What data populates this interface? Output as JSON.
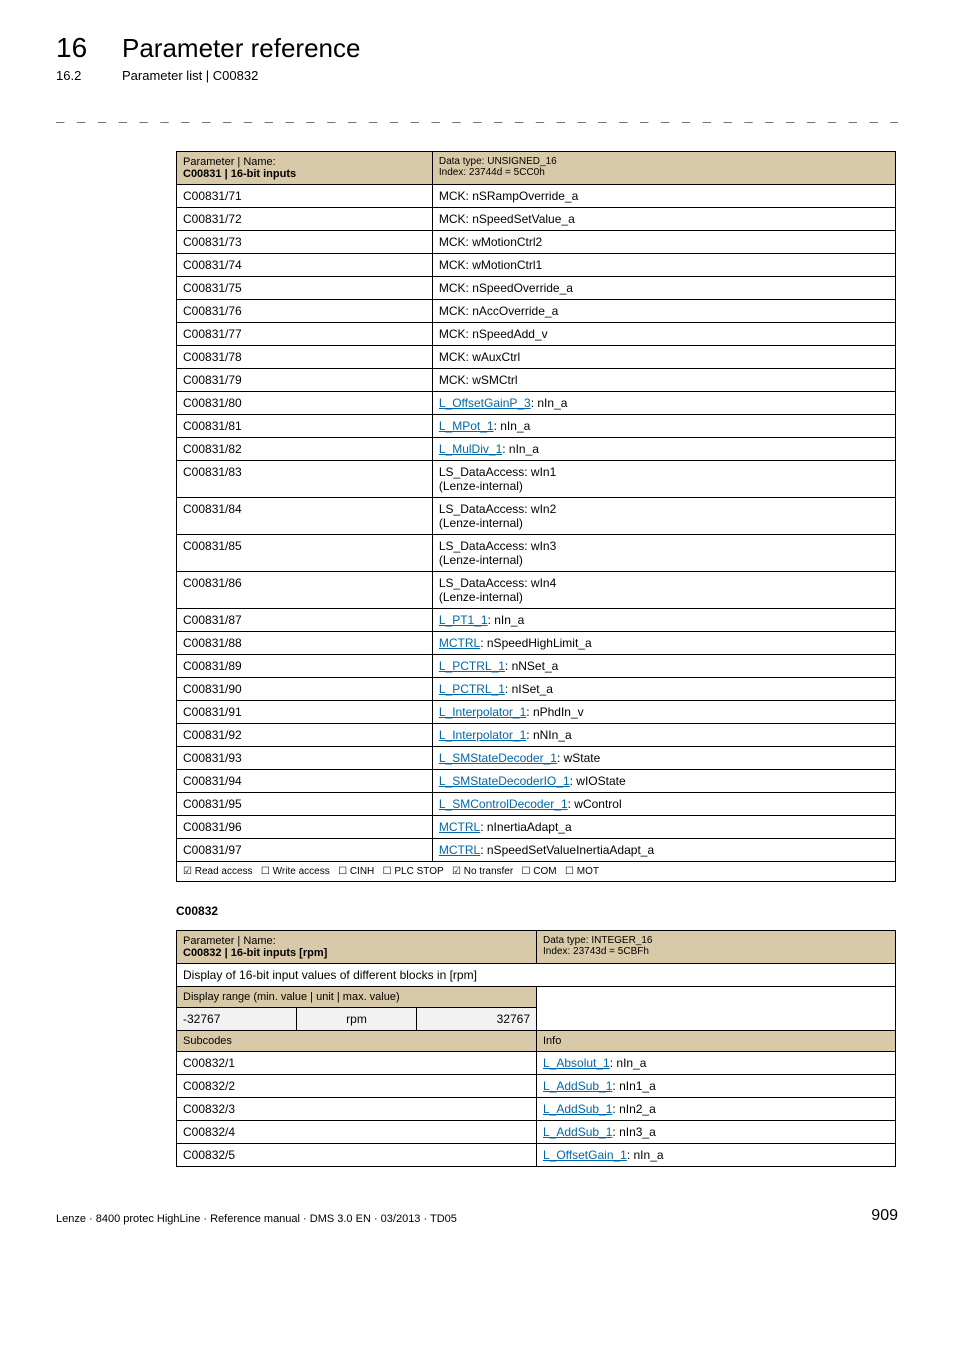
{
  "header": {
    "chapter_num": "16",
    "chapter_title": "Parameter reference",
    "sub_num": "16.2",
    "sub_title": "Parameter list | C00832"
  },
  "table1": {
    "hdr_left_line1": "Parameter | Name:",
    "hdr_left_line2": "C00831 | 16-bit inputs",
    "hdr_right_line1": "Data type: UNSIGNED_16",
    "hdr_right_line2": "Index: 23744d = 5CC0h",
    "rows": [
      {
        "c1": "C00831/71",
        "c2": "MCK: nSRampOverride_a",
        "link": null,
        "suffix": null
      },
      {
        "c1": "C00831/72",
        "c2": "MCK: nSpeedSetValue_a",
        "link": null,
        "suffix": null
      },
      {
        "c1": "C00831/73",
        "c2": "MCK: wMotionCtrl2",
        "link": null,
        "suffix": null
      },
      {
        "c1": "C00831/74",
        "c2": "MCK: wMotionCtrl1",
        "link": null,
        "suffix": null
      },
      {
        "c1": "C00831/75",
        "c2": "MCK: nSpeedOverride_a",
        "link": null,
        "suffix": null
      },
      {
        "c1": "C00831/76",
        "c2": "MCK: nAccOverride_a",
        "link": null,
        "suffix": null
      },
      {
        "c1": "C00831/77",
        "c2": "MCK: nSpeedAdd_v",
        "link": null,
        "suffix": null
      },
      {
        "c1": "C00831/78",
        "c2": "MCK: wAuxCtrl",
        "link": null,
        "suffix": null
      },
      {
        "c1": "C00831/79",
        "c2": "MCK: wSMCtrl",
        "link": null,
        "suffix": null
      },
      {
        "c1": "C00831/80",
        "c2": null,
        "link": "L_OffsetGainP_3",
        "suffix": ": nIn_a"
      },
      {
        "c1": "C00831/81",
        "c2": null,
        "link": "L_MPot_1",
        "suffix": ": nIn_a"
      },
      {
        "c1": "C00831/82",
        "c2": null,
        "link": "L_MulDiv_1",
        "suffix": ": nIn_a"
      },
      {
        "c1": "C00831/83",
        "c2": "LS_DataAccess: wIn1\n(Lenze-internal)",
        "link": null,
        "suffix": null
      },
      {
        "c1": "C00831/84",
        "c2": "LS_DataAccess: wIn2\n(Lenze-internal)",
        "link": null,
        "suffix": null
      },
      {
        "c1": "C00831/85",
        "c2": "LS_DataAccess: wIn3\n(Lenze-internal)",
        "link": null,
        "suffix": null
      },
      {
        "c1": "C00831/86",
        "c2": "LS_DataAccess: wIn4\n(Lenze-internal)",
        "link": null,
        "suffix": null
      },
      {
        "c1": "C00831/87",
        "c2": null,
        "link": "L_PT1_1",
        "suffix": ": nIn_a"
      },
      {
        "c1": "C00831/88",
        "c2": null,
        "link": "MCTRL",
        "suffix": ": nSpeedHighLimit_a"
      },
      {
        "c1": "C00831/89",
        "c2": null,
        "link": "L_PCTRL_1",
        "suffix": ": nNSet_a"
      },
      {
        "c1": "C00831/90",
        "c2": null,
        "link": "L_PCTRL_1",
        "suffix": ": nISet_a"
      },
      {
        "c1": "C00831/91",
        "c2": null,
        "link": "L_Interpolator_1",
        "suffix": ": nPhdIn_v"
      },
      {
        "c1": "C00831/92",
        "c2": null,
        "link": "L_Interpolator_1",
        "suffix": ": nNIn_a"
      },
      {
        "c1": "C00831/93",
        "c2": null,
        "link": "L_SMStateDecoder_1",
        "suffix": ": wState"
      },
      {
        "c1": "C00831/94",
        "c2": null,
        "link": "L_SMStateDecoderIO_1",
        "suffix": ": wIOState"
      },
      {
        "c1": "C00831/95",
        "c2": null,
        "link": "L_SMControlDecoder_1",
        "suffix": ": wControl"
      },
      {
        "c1": "C00831/96",
        "c2": null,
        "link": "MCTRL",
        "suffix": ": nInertiaAdapt_a"
      },
      {
        "c1": "C00831/97",
        "c2": null,
        "link": "MCTRL",
        "suffix": ": nSpeedSetValueInertiaAdapt_a"
      }
    ],
    "access": {
      "read": "Read access",
      "write": "Write access",
      "cinh": "CINH",
      "plcstop": "PLC STOP",
      "notransfer": "No transfer",
      "com": "COM",
      "mot": "MOT"
    }
  },
  "section_label": "C00832",
  "table2": {
    "hdr_left_line1": "Parameter | Name:",
    "hdr_left_line2": "C00832 | 16-bit inputs [rpm]",
    "hdr_right_line1": "Data type: INTEGER_16",
    "hdr_right_line2": "Index: 23743d = 5CBFh",
    "desc": "Display of 16-bit input values of different blocks in [rpm]",
    "range_label": "Display range (min. value | unit | max. value)",
    "range_min": "-32767",
    "range_unit": "rpm",
    "range_max": "32767",
    "sub_h1": "Subcodes",
    "sub_h2": "Info",
    "rows": [
      {
        "c1": "C00832/1",
        "link": "L_Absolut_1",
        "suffix": ": nIn_a"
      },
      {
        "c1": "C00832/2",
        "link": "L_AddSub_1",
        "suffix": ": nIn1_a"
      },
      {
        "c1": "C00832/3",
        "link": "L_AddSub_1",
        "suffix": ": nIn2_a"
      },
      {
        "c1": "C00832/4",
        "link": "L_AddSub_1",
        "suffix": ": nIn3_a"
      },
      {
        "c1": "C00832/5",
        "link": "L_OffsetGain_1",
        "suffix": ": nIn_a"
      }
    ]
  },
  "footer": {
    "left": "Lenze · 8400 protec HighLine · Reference manual · DMS 3.0 EN · 03/2013 · TD05",
    "right": "909"
  },
  "glyphs": {
    "check": "☑",
    "uncheck": "☐",
    "dashes": "_ _ _ _ _ _ _ _ _ _ _ _ _ _ _ _ _ _ _ _ _ _ _ _ _ _ _ _ _ _ _ _ _ _ _ _ _ _ _ _ _ _ _ _ _ _ _ _ _ _ _ _ _ _ _ _ _ _ _ _ _ _ _"
  }
}
